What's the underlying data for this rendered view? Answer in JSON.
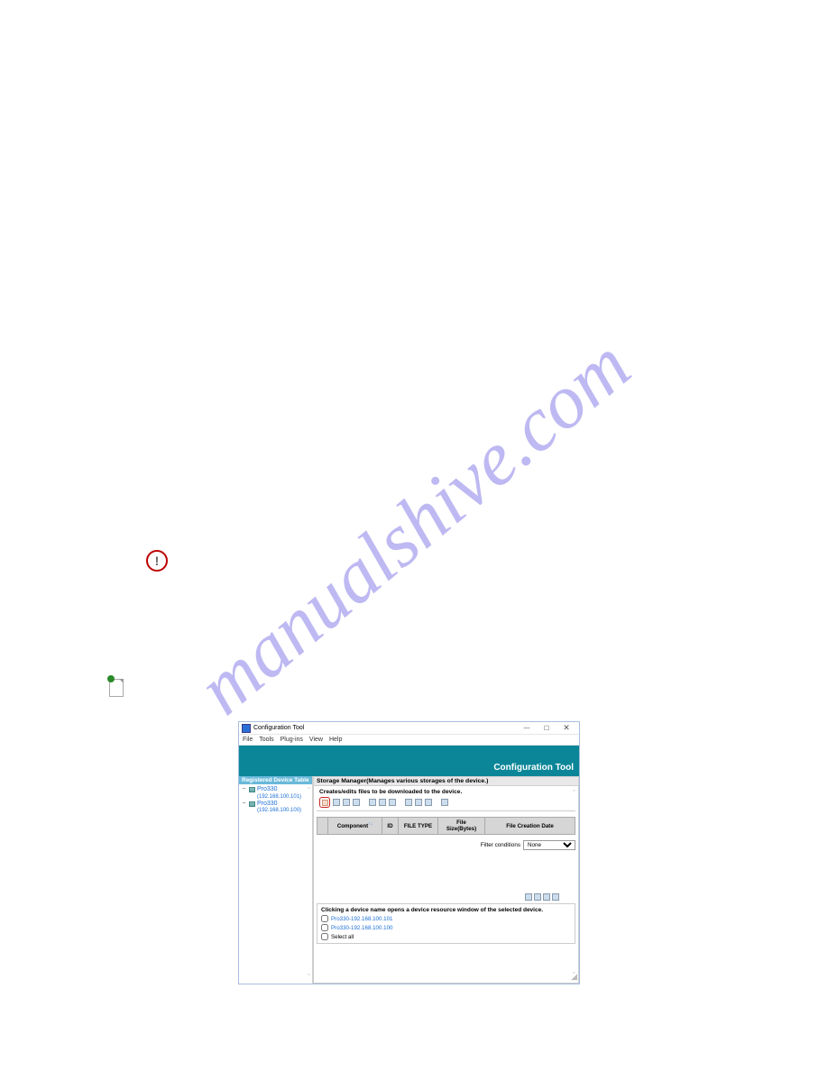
{
  "watermark_text": "manualshive.com",
  "window": {
    "title": "Configuration Tool",
    "min": "—",
    "max": "☐",
    "close": "✕",
    "menu": [
      "File",
      "Tools",
      "Plug-ins",
      "View",
      "Help"
    ],
    "banner": "Configuration Tool",
    "tree": {
      "header": "Registered Device Table",
      "items": [
        {
          "name": "Pro330",
          "ip": "(192.168.100.101)"
        },
        {
          "name": "Pro330",
          "ip": "(192.168.100.100)"
        }
      ]
    },
    "main": {
      "title": "Storage Manager(Manages various storages of the device.)",
      "subtitle": "Creates/edits files to be downloaded to the device.",
      "headers": {
        "blank": "",
        "component": "Component",
        "id": "ID",
        "filetype": "FILE TYPE",
        "filesize": "File Size(Bytes)",
        "creation": "File Creation Date"
      },
      "sort_arrow": "↑↓",
      "filter_label": "Filter conditions",
      "filter_value": "None",
      "device_desc": "Clicking a device name opens a device resource window of the selected device.",
      "devices": [
        "Pro330-192.168.100.101",
        "Pro330-192.168.100.100"
      ],
      "select_all": "Select all"
    }
  }
}
